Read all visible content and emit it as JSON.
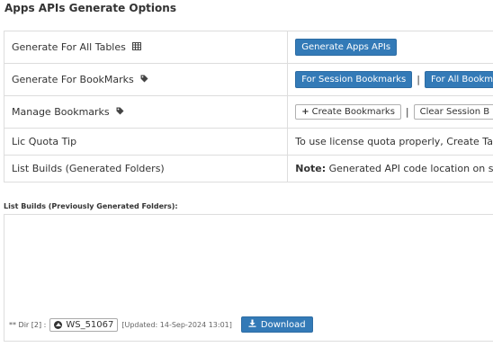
{
  "page_title": "Apps APIs Generate Options",
  "rows": {
    "all_tables": {
      "label": "Generate For All Tables",
      "button": "Generate Apps APIs"
    },
    "bookmarks": {
      "label": "Generate For BookMarks",
      "session_button": "For Session Bookmarks",
      "all_button": "For All Bookm"
    },
    "manage": {
      "label": "Manage Bookmarks",
      "create_button": "Create Bookmarks",
      "clear_button": "Clear Session B"
    },
    "quota": {
      "label": "Lic Quota Tip",
      "text": "To use license quota properly, Create Ta"
    },
    "builds": {
      "label": "List Builds (Generated Folders)",
      "note_label": "Note:",
      "note_text": "Generated API code location on s"
    }
  },
  "separator": "|",
  "list_builds": {
    "heading": "List Builds (Previously Generated Folders):",
    "dir_label": "** Dir [2] :",
    "folder": "WS_51067",
    "updated": "[Updated: 14-Sep-2024 13:01]",
    "download_label": "Download"
  },
  "colors": {
    "primary": "#337ab7",
    "border": "#dddddd"
  },
  "icons": [
    "table-icon",
    "tag-icon",
    "plus-icon",
    "circle-arrow-icon",
    "download-icon"
  ]
}
